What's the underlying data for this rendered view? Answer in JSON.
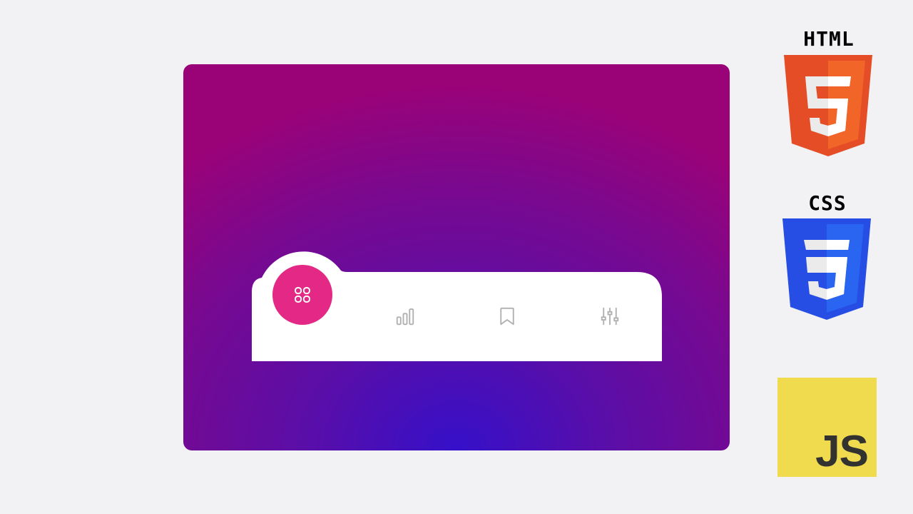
{
  "navbar": {
    "items": [
      {
        "icon": "grid-icon",
        "active": true
      },
      {
        "icon": "bar-chart-icon",
        "active": false
      },
      {
        "icon": "bookmark-icon",
        "active": false
      },
      {
        "icon": "sliders-icon",
        "active": false
      }
    ]
  },
  "colors": {
    "accent": "#e32886",
    "bar": "#ffffff",
    "inactive_icon": "#b0b0b0",
    "html_orange": "#e44d26",
    "css_blue": "#264de4",
    "js_yellow": "#f0db4f"
  },
  "logos": {
    "html_label": "HTML",
    "html_digit": "5",
    "css_label": "CSS",
    "css_digit": "3",
    "js_label": "JS"
  }
}
